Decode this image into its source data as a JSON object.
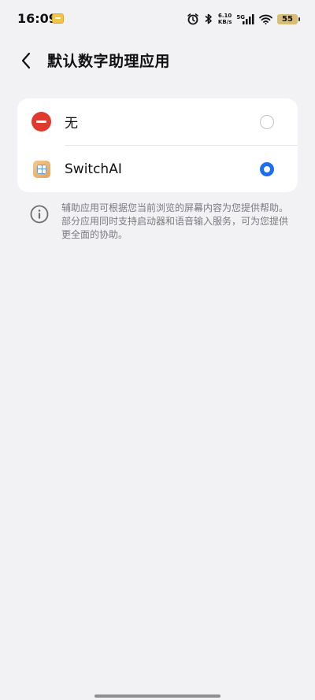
{
  "status_bar": {
    "time": "16:09",
    "net_speed_value": "6.10",
    "net_speed_unit": "KB/s",
    "net_type": "5G",
    "battery": "55",
    "battery_color": "#d7be74"
  },
  "header": {
    "title": "默认数字助理应用"
  },
  "options": [
    {
      "label": "无",
      "icon": "none-icon",
      "selected": false
    },
    {
      "label": "SwitchAI",
      "icon": "switchai-app-icon",
      "selected": true
    }
  ],
  "info": {
    "text": "辅助应用可根据您当前浏览的屏幕内容为您提供帮助。部分应用同时支持启动器和语音输入服务，可为您提供更全面的协助。"
  },
  "colors": {
    "accent": "#1e6ff0",
    "none_red": "#e03a2f",
    "background": "#f2f2f5"
  }
}
